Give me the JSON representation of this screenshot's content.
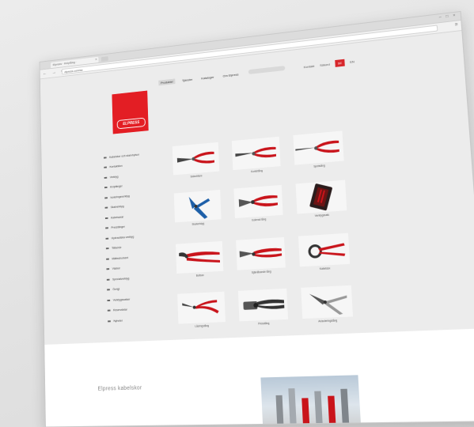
{
  "browser": {
    "tab_title": "Elpress · Kniptång · ",
    "tab_close": "×",
    "url": "elpress.com/se",
    "nav_buttons": "← → ⟳",
    "window_controls": "– □ ×",
    "menu_icon": "≡"
  },
  "topnav": {
    "items": [
      "Produkter",
      "Tjänster",
      "Kataloger",
      "Om Elpress"
    ],
    "active_index": 0
  },
  "topright": {
    "contact": "Kontakt",
    "search": "Sökord",
    "lang_active": "SE",
    "lang_other": "EN"
  },
  "logo": {
    "text": "ELPRESS",
    "brand_color": "#e31e24"
  },
  "sidebar": {
    "items": [
      "Kabelskor och skarvhylsor",
      "Kontaktdon",
      "Verktyg",
      "Kniptänger",
      "Isoleringsverktyg",
      "Skalverktyg",
      "Kabelsaxar",
      "Presstänger",
      "Hydrauliska verktyg",
      "Tillbehör",
      "Mätinstrument",
      "Väskor",
      "Specialverktyg",
      "Övrigt",
      "Verktygssatser",
      "Reservdelar",
      "Nyheter"
    ]
  },
  "products": {
    "captions": [
      "Sidavbitare",
      "Kombitång",
      "Spetstång",
      "Skalverktyg",
      "Isolerad tång",
      "Verktygssats",
      "Bultsax",
      "Självlåsande tång",
      "Kabelsax",
      "Låsringstång",
      "Presstång",
      "Avisoleringstång"
    ],
    "accent_color": "#c9141b"
  },
  "lower": {
    "title": "Elpress kabelskor"
  }
}
